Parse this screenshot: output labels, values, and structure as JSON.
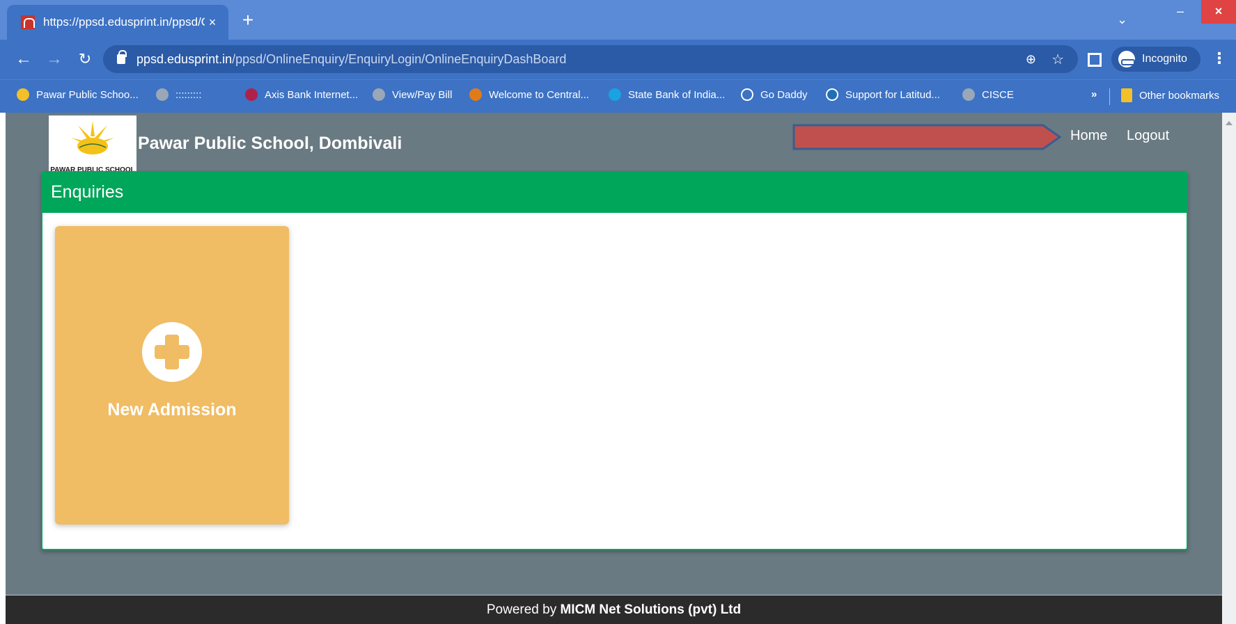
{
  "browser": {
    "tab_title": "https://ppsd.edusprint.in/ppsd/O",
    "tab_close": "×",
    "new_tab": "+",
    "tab_search": "⌄",
    "window": {
      "minimize": "–",
      "maximize": "▢",
      "close": "×"
    },
    "nav": {
      "back": "←",
      "forward": "→",
      "reload": "↻"
    },
    "url_host": "ppsd.edusprint.in",
    "url_path": "/ppsd/OnlineEnquiry/EnquiryLogin/OnlineEnquiryDashBoard",
    "zoom_icon": "⊕",
    "star_icon": "☆",
    "incognito_label": "Incognito",
    "menu": "⋮"
  },
  "bookmarks": [
    {
      "label": "Pawar Public Schoo...",
      "color": "#f2c028"
    },
    {
      "label": ":::::::::",
      "color": "#9aa7b8"
    },
    {
      "label": "Axis Bank Internet...",
      "color": "#b0214a"
    },
    {
      "label": "View/Pay Bill",
      "color": "#9aa7b8"
    },
    {
      "label": "Welcome to Central...",
      "color": "#e07b1a"
    },
    {
      "label": "State Bank of India...",
      "color": "#1aa3e0"
    },
    {
      "label": "Go Daddy",
      "color": "#3d72c4"
    },
    {
      "label": "Support for Latitud...",
      "color": "#1f6fb5"
    },
    {
      "label": "CISCE",
      "color": "#9aa7b8"
    }
  ],
  "bookmarks_more": "»",
  "other_bookmarks": "Other bookmarks",
  "header": {
    "logo_text": "PAWAR PUBLIC SCHOOL",
    "school_name": "Pawar Public School, Dombivali",
    "home": "Home",
    "logout": "Logout"
  },
  "panel": {
    "title": "Enquiries",
    "tiles": [
      {
        "label": "New Admission"
      }
    ]
  },
  "footer": {
    "prefix": "Powered by ",
    "company": "MICM Net Solutions (pvt) Ltd"
  },
  "colors": {
    "tab_strip": "#5b8ad6",
    "toolbar": "#3d72c4",
    "page_bg": "#697a82",
    "panel_accent": "#00a65a",
    "tile": "#f0bc64",
    "footer": "#2b2b2b",
    "redaction": "#c0504d"
  }
}
